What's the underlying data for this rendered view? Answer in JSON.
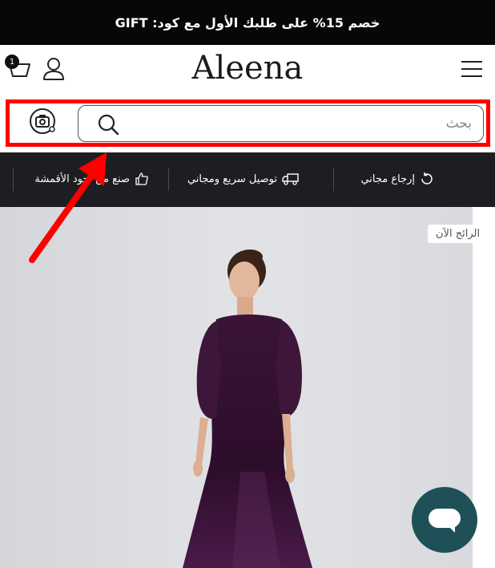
{
  "promo": {
    "text": "خصم 15% على طلبك الأول مع كود: GIFT"
  },
  "header": {
    "logo": "Aleena",
    "cart_count": "1",
    "cart_icon": "basket-icon",
    "account_icon": "user-icon",
    "menu_icon": "hamburger-menu-icon"
  },
  "search": {
    "placeholder": "بحث",
    "search_icon": "search-icon",
    "camera_icon": "camera-search-icon",
    "highlight_color": "#ff0000"
  },
  "features": [
    {
      "label": "إرجاع مجاني",
      "icon": "return-arrow-icon"
    },
    {
      "label": "توصيل سريع ومجاني",
      "icon": "truck-icon"
    },
    {
      "label": "صنع من أجود الأقمشة",
      "icon": "thumbs-up-icon"
    }
  ],
  "hero": {
    "badge": "الرائج الآن",
    "product_color": "#3b1538"
  },
  "chat": {
    "icon": "chat-bubble-icon",
    "color": "#1f5058"
  },
  "colors": {
    "promo_bg": "#070707",
    "features_bg": "#1e1e22",
    "hero_bg": "#dcdde1",
    "annotation": "#ff0000"
  }
}
